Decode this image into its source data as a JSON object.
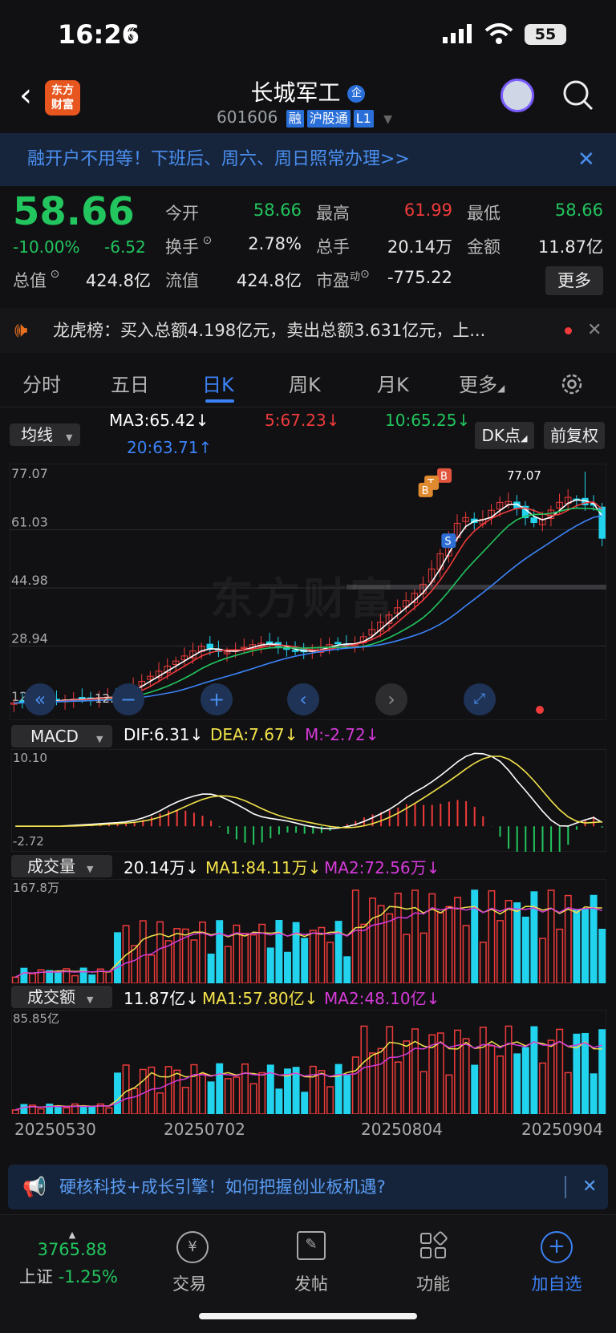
{
  "status_bar": {
    "time": "16:26",
    "battery": "55"
  },
  "header": {
    "logo_line1": "东方",
    "logo_line2": "财富",
    "stock_name": "长城军工",
    "badge_qi": "企",
    "stock_code": "601606",
    "tag_rong": "融",
    "tag_hgt": "沪股通",
    "tag_l1": "L1"
  },
  "banner": {
    "text": "融开户不用等！下班后、周六、周日照常办理>>"
  },
  "quote": {
    "price": "58.66",
    "change_pct": "-10.00%",
    "change_amt": "-6.52",
    "open_label": "今开",
    "open": "58.66",
    "high_label": "最高",
    "high": "61.99",
    "low_label": "最低",
    "low": "58.66",
    "turnover_label": "换手",
    "turnover": "2.78%",
    "volume_label": "总手",
    "volume": "20.14万",
    "amount_label": "金额",
    "amount": "11.87亿",
    "mktcap_label": "总值",
    "mktcap": "424.8亿",
    "float_label": "流值",
    "float_cap": "424.8亿",
    "pe_label": "市盈",
    "pe_sup": "动",
    "pe": "-775.22",
    "more": "更多"
  },
  "lhb": {
    "text": "龙虎榜：买入总额4.198亿元，卖出总额3.631亿元，上..."
  },
  "tabs": [
    "分时",
    "五日",
    "日K",
    "周K",
    "月K",
    "更多"
  ],
  "active_tab": "日K",
  "kline": {
    "indicator_select": "均线",
    "ma3": "MA3:65.42↓",
    "ma5": "5:67.23↓",
    "ma10": "10:65.25↓",
    "ma20": "20:63.71↑",
    "dk_button": "DK点",
    "fq_button": "前复权",
    "y_labels": [
      "77.07",
      "61.03",
      "44.98",
      "28.94",
      "12.89"
    ],
    "max_marker": "77.07",
    "min_marker": "12.89",
    "watermark": "东方财富"
  },
  "macd": {
    "select": "MACD",
    "dif": "DIF:6.31↓",
    "dea": "DEA:7.67↓",
    "m": "M:-2.72↓",
    "y_top": "10.10",
    "y_bottom": "-2.72"
  },
  "volume": {
    "select": "成交量",
    "v": "20.14万↓",
    "ma1": "MA1:84.11万↓",
    "ma2": "MA2:72.56万↓",
    "y_top": "167.8万"
  },
  "amount": {
    "select": "成交额",
    "v": "11.87亿↓",
    "ma1": "MA1:57.80亿↓",
    "ma2": "MA2:48.10亿↓",
    "y_top": "85.85亿"
  },
  "dates": [
    "20250530",
    "20250702",
    "20250804",
    "20250904"
  ],
  "ad": {
    "text": "硬核科技+成长引擎！如何把握创业板机遇?"
  },
  "bottom_nav": {
    "index_value": "3765.88",
    "index_name": "上证",
    "index_change": "-1.25%",
    "trade": "交易",
    "post": "发帖",
    "func": "功能",
    "add": "加自选"
  },
  "colors": {
    "up": "#ef3b3b",
    "down": "#22c55e",
    "accent": "#3b82f6",
    "ma3": "#ffffff",
    "ma5": "#ef3b3b",
    "ma10": "#22c55e",
    "ma20": "#3b82f6"
  }
}
